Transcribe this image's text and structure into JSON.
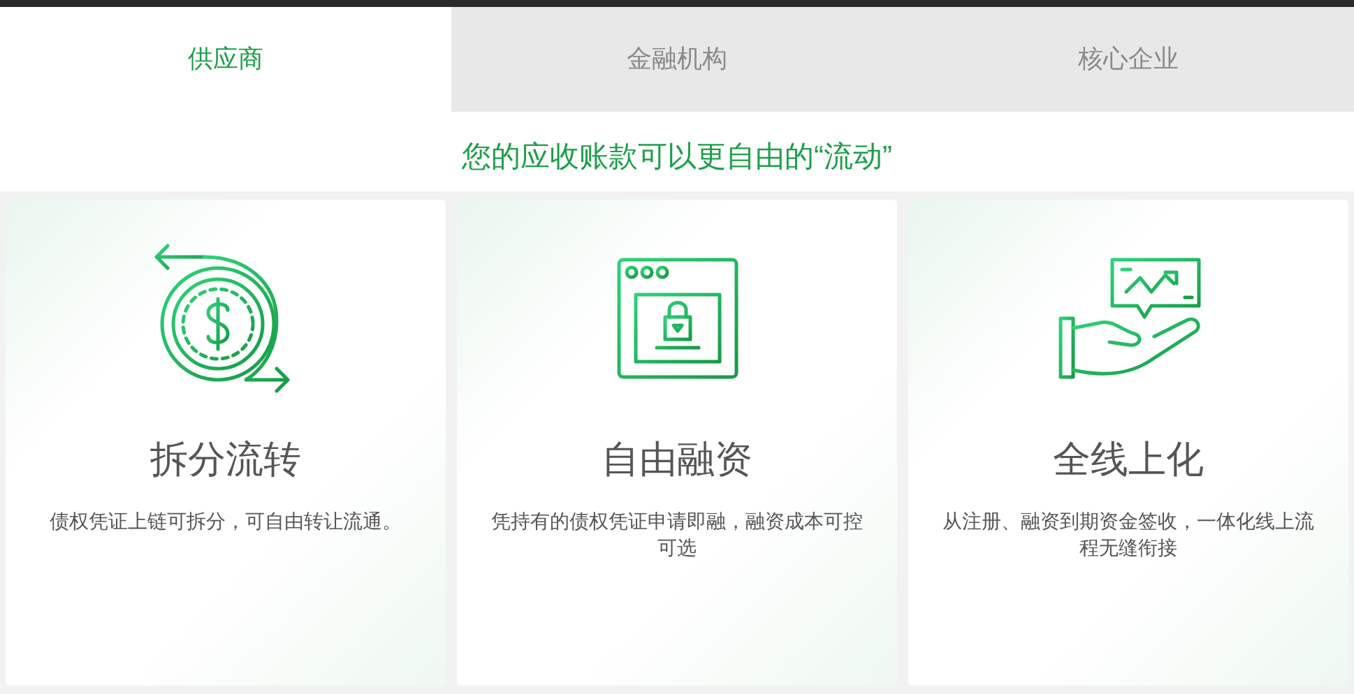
{
  "tabs": [
    {
      "label": "供应商",
      "selected": true
    },
    {
      "label": "金融机构",
      "selected": false
    },
    {
      "label": "核心企业",
      "selected": false
    }
  ],
  "headline": "您的应收账款可以更自由的“流动”",
  "cards": [
    {
      "kind": "coin",
      "title": "拆分流转",
      "description": "债权凭证上链可拆分，可自由转让流通。"
    },
    {
      "kind": "lock",
      "title": "自由融资",
      "description": "凭持有的债权凭证申请即融，融资成本可控可选"
    },
    {
      "kind": "hand",
      "title": "全线上化",
      "description": "从注册、融资到期资金签收，一体化线上流程无缝衔接"
    }
  ]
}
